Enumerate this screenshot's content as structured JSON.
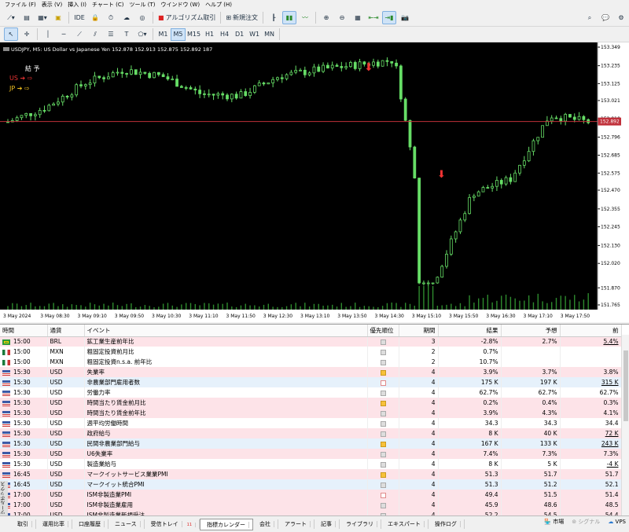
{
  "menu": [
    "ファイル (F)",
    "表示 (V)",
    "挿入 (I)",
    "チャート (C)",
    "ツール (T)",
    "ウインドウ (W)",
    "ヘルプ (H)"
  ],
  "toolbar": {
    "ide": "IDE",
    "algo": "アルゴリズム取引",
    "new_order": "新規注文"
  },
  "timeframes": [
    "M1",
    "M5",
    "M15",
    "H1",
    "H4",
    "D1",
    "W1",
    "MN"
  ],
  "active_timeframe": "M5",
  "chart": {
    "info": "USDJPY, M5: US Dollar vs Japanese Yen 152.878 152.913 152.875 152.892 187",
    "current_price": "152.892",
    "legend": {
      "title": "結 予",
      "us": "US",
      "jp": "JP"
    },
    "y_labels": [
      "153.349",
      "153.235",
      "153.125",
      "153.021",
      "152.910",
      "152.796",
      "152.685",
      "152.575",
      "152.470",
      "152.355",
      "152.245",
      "152.130",
      "152.020",
      "151.870",
      "151.765"
    ],
    "x_labels": [
      "3 May 2024",
      "3 May 08:30",
      "3 May 09:10",
      "3 May 09:50",
      "3 May 10:30",
      "3 May 11:10",
      "3 May 11:50",
      "3 May 12:30",
      "3 May 13:10",
      "3 May 13:50",
      "3 May 14:30",
      "3 May 15:10",
      "3 May 15:50",
      "3 May 16:30",
      "3 May 17:10",
      "3 May 17:50"
    ]
  },
  "chart_data": {
    "type": "line",
    "title": "",
    "x": [
      "08:30",
      "09:10",
      "09:50",
      "10:30",
      "11:10",
      "11:50",
      "12:30",
      "13:10",
      "13:50",
      "14:30",
      "15:10",
      "15:30",
      "15:50",
      "16:30",
      "17:10",
      "17:50"
    ],
    "y": [
      152.89,
      152.98,
      153.13,
      153.21,
      153.17,
      153.06,
      153.05,
      153.17,
      153.21,
      153.24,
      153.27,
      151.9,
      152.45,
      152.54,
      152.93,
      152.89
    ],
    "ylim": [
      151.765,
      153.349
    ]
  },
  "calendar": {
    "headers": [
      "時間",
      "通貨",
      "イベント",
      "優先順位",
      "期間",
      "結果",
      "予想",
      "前"
    ],
    "rows": [
      {
        "time": "15:00",
        "cur": "BRL",
        "event": "鉱工業生産前年比",
        "pri": "g",
        "period": "3",
        "result": "-2.8%",
        "forecast": "2.7%",
        "prev": "5.4%",
        "ul": true,
        "bg": "hi",
        "flag": "br"
      },
      {
        "time": "15:00",
        "cur": "MXN",
        "event": "粗固定投資前月比",
        "pri": "g",
        "period": "2",
        "result": "0.7%",
        "forecast": "",
        "prev": "",
        "ul": false,
        "bg": "lo",
        "flag": "mx"
      },
      {
        "time": "15:00",
        "cur": "MXN",
        "event": "粗固定投資n.s.a. 前年比",
        "pri": "g",
        "period": "2",
        "result": "10.7%",
        "forecast": "",
        "prev": "",
        "ul": false,
        "bg": "lo",
        "flag": "mx"
      },
      {
        "time": "15:30",
        "cur": "USD",
        "event": "失業率",
        "pri": "y",
        "period": "4",
        "result": "3.9%",
        "forecast": "3.7%",
        "prev": "3.8%",
        "ul": false,
        "bg": "hi",
        "flag": "us"
      },
      {
        "time": "15:30",
        "cur": "USD",
        "event": "非農業部門雇用者数",
        "pri": "p",
        "period": "4",
        "result": "175 K",
        "forecast": "197 K",
        "prev": "315 K",
        "ul": true,
        "bg": "bl",
        "flag": "us"
      },
      {
        "time": "15:30",
        "cur": "USD",
        "event": "労働力率",
        "pri": "g",
        "period": "4",
        "result": "62.7%",
        "forecast": "62.7%",
        "prev": "62.7%",
        "ul": false,
        "bg": "lo",
        "flag": "us"
      },
      {
        "time": "15:30",
        "cur": "USD",
        "event": "時間当たり賃金前月比",
        "pri": "y",
        "period": "4",
        "result": "0.2%",
        "forecast": "0.4%",
        "prev": "0.3%",
        "ul": false,
        "bg": "hi",
        "flag": "us"
      },
      {
        "time": "15:30",
        "cur": "USD",
        "event": "時間当たり賃金前年比",
        "pri": "g",
        "period": "4",
        "result": "3.9%",
        "forecast": "4.3%",
        "prev": "4.1%",
        "ul": false,
        "bg": "hi",
        "flag": "us"
      },
      {
        "time": "15:30",
        "cur": "USD",
        "event": "週平均労働時間",
        "pri": "g",
        "period": "4",
        "result": "34.3",
        "forecast": "34.3",
        "prev": "34.4",
        "ul": false,
        "bg": "lo",
        "flag": "us"
      },
      {
        "time": "15:30",
        "cur": "USD",
        "event": "政府給与",
        "pri": "g",
        "period": "4",
        "result": "8 K",
        "forecast": "40 K",
        "prev": "72 K",
        "ul": true,
        "bg": "hi",
        "flag": "us"
      },
      {
        "time": "15:30",
        "cur": "USD",
        "event": "民間非農業部門給与",
        "pri": "y",
        "period": "4",
        "result": "167 K",
        "forecast": "133 K",
        "prev": "243 K",
        "ul": true,
        "bg": "bl",
        "flag": "us"
      },
      {
        "time": "15:30",
        "cur": "USD",
        "event": "U6失業率",
        "pri": "g",
        "period": "4",
        "result": "7.4%",
        "forecast": "7.3%",
        "prev": "7.3%",
        "ul": false,
        "bg": "hi",
        "flag": "us"
      },
      {
        "time": "15:30",
        "cur": "USD",
        "event": "製造業給与",
        "pri": "g",
        "period": "4",
        "result": "8 K",
        "forecast": "5 K",
        "prev": "-4 K",
        "ul": true,
        "bg": "lo",
        "flag": "us"
      },
      {
        "time": "16:45",
        "cur": "USD",
        "event": "マークイットサービス業業PMI",
        "pri": "y",
        "period": "4",
        "result": "51.3",
        "forecast": "51.7",
        "prev": "51.7",
        "ul": false,
        "bg": "hi",
        "flag": "us"
      },
      {
        "time": "16:45",
        "cur": "USD",
        "event": "マークイット統合PMI",
        "pri": "g",
        "period": "4",
        "result": "51.3",
        "forecast": "51.2",
        "prev": "52.1",
        "ul": false,
        "bg": "bl",
        "flag": "us"
      },
      {
        "time": "17:00",
        "cur": "USD",
        "event": "ISM非製造業PMI",
        "pri": "p",
        "period": "4",
        "result": "49.4",
        "forecast": "51.5",
        "prev": "51.4",
        "ul": false,
        "bg": "hi",
        "flag": "us"
      },
      {
        "time": "17:00",
        "cur": "USD",
        "event": "ISM非製造業雇用",
        "pri": "g",
        "period": "4",
        "result": "45.9",
        "forecast": "48.6",
        "prev": "48.5",
        "ul": false,
        "bg": "hi",
        "flag": "us"
      },
      {
        "time": "17:00",
        "cur": "USD",
        "event": "ISM非製造業新規受注",
        "pri": "g",
        "period": "4",
        "result": "52.2",
        "forecast": "54.5",
        "prev": "54.4",
        "ul": false,
        "bg": "hi",
        "flag": "us"
      }
    ]
  },
  "tabs": [
    "取引",
    "運用比率",
    "口座履歴",
    "ニュース",
    "受信トレイ",
    "指標カレンダー",
    "会社",
    "アラート",
    "記事",
    "ライブラリ",
    "エキスパート",
    "操作ログ"
  ],
  "active_tab": "指標カレンダー",
  "inbox_count": "11",
  "side_label": "ツールボックス",
  "status": {
    "market": "市場",
    "signals": "シグナル",
    "vps": "VPS"
  }
}
